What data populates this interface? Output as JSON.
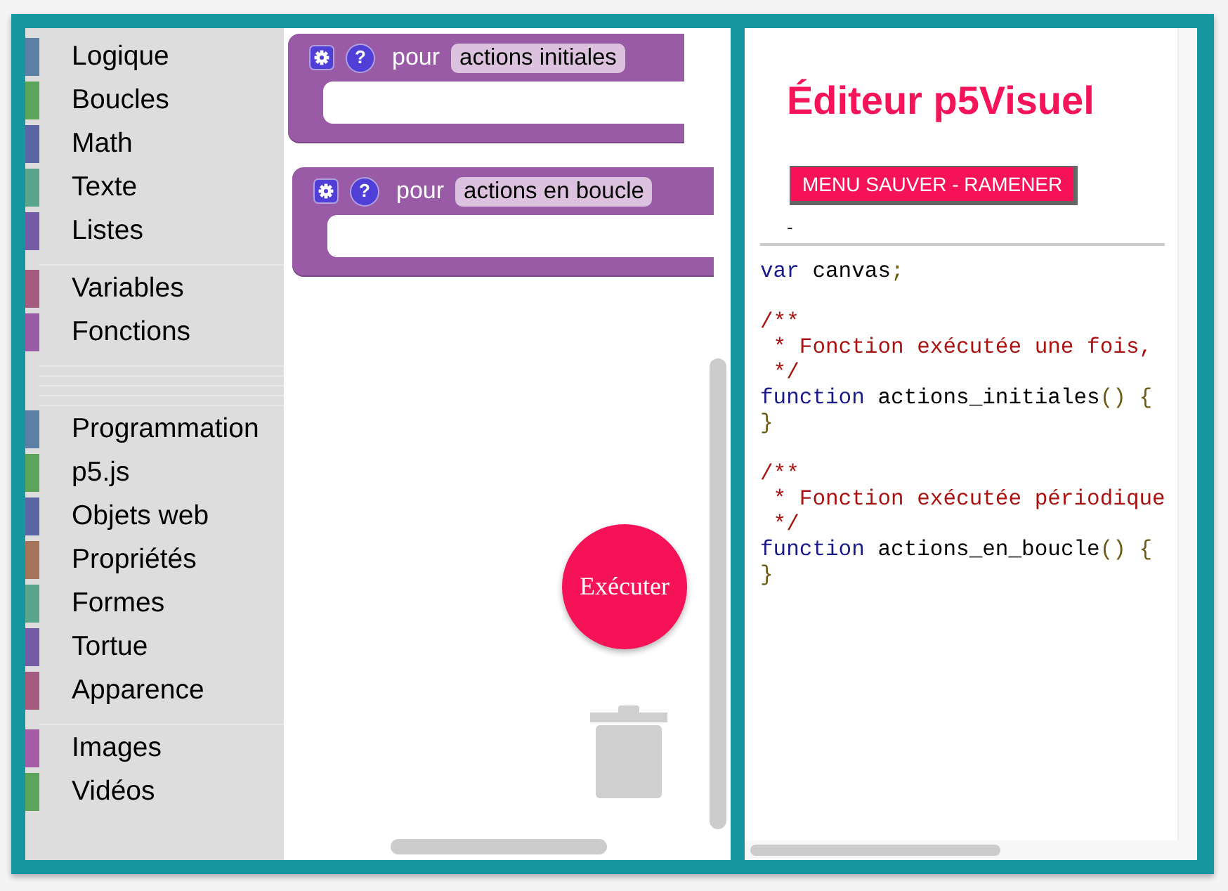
{
  "toolbox": {
    "entries": [
      {
        "kind": "category",
        "label": "Logique",
        "color": "#5b80a5"
      },
      {
        "kind": "category",
        "label": "Boucles",
        "color": "#5ba55b"
      },
      {
        "kind": "category",
        "label": "Math",
        "color": "#5b67a5"
      },
      {
        "kind": "category",
        "label": "Texte",
        "color": "#5ba58c"
      },
      {
        "kind": "category",
        "label": "Listes",
        "color": "#745ba5"
      },
      {
        "kind": "separator"
      },
      {
        "kind": "category",
        "label": "Variables",
        "color": "#a55b80"
      },
      {
        "kind": "category",
        "label": "Fonctions",
        "color": "#995ba5"
      },
      {
        "kind": "separator"
      },
      {
        "kind": "separator"
      },
      {
        "kind": "separator"
      },
      {
        "kind": "separator"
      },
      {
        "kind": "separator"
      },
      {
        "kind": "category",
        "label": "Programmation",
        "color": "#5b80a5"
      },
      {
        "kind": "category",
        "label": "p5.js",
        "color": "#5ba55b"
      },
      {
        "kind": "category",
        "label": "Objets web",
        "color": "#5b67a5"
      },
      {
        "kind": "category",
        "label": "Propriétés",
        "color": "#a5745b"
      },
      {
        "kind": "category",
        "label": "Formes",
        "color": "#5ba58c"
      },
      {
        "kind": "category",
        "label": "Tortue",
        "color": "#745ba5"
      },
      {
        "kind": "category",
        "label": "Apparence",
        "color": "#a55b80"
      },
      {
        "kind": "separator"
      },
      {
        "kind": "category",
        "label": "Images",
        "color": "#a55ba5"
      },
      {
        "kind": "category",
        "label": "Vidéos",
        "color": "#5ba55b"
      }
    ]
  },
  "workspace": {
    "blocks": [
      {
        "help": "?",
        "keyword": "pour",
        "field": "actions initiales"
      },
      {
        "help": "?",
        "keyword": "pour",
        "field": "actions en boucle"
      }
    ],
    "run_button": "Exécuter"
  },
  "editor": {
    "title": "Éditeur p5Visuel",
    "menu_button": "MENU SAUVER - RAMENER",
    "dash": "-",
    "code_blocks": [
      [
        [
          {
            "kind": "keyword",
            "text": "var"
          },
          {
            "kind": "plain",
            "text": " canvas"
          },
          {
            "kind": "punct",
            "text": ";"
          }
        ]
      ],
      [
        [
          {
            "kind": "comment",
            "text": "/**"
          }
        ],
        [
          {
            "kind": "comment",
            "text": " * Fonction exécutée une fois,"
          }
        ],
        [
          {
            "kind": "comment",
            "text": " */"
          }
        ],
        [
          {
            "kind": "keyword",
            "text": "function"
          },
          {
            "kind": "plain",
            "text": " actions_initiales"
          },
          {
            "kind": "punct",
            "text": "() {"
          }
        ],
        [
          {
            "kind": "punct",
            "text": "}"
          }
        ]
      ],
      [
        [
          {
            "kind": "comment",
            "text": "/**"
          }
        ],
        [
          {
            "kind": "comment",
            "text": " * Fonction exécutée périodique"
          }
        ],
        [
          {
            "kind": "comment",
            "text": " */"
          }
        ],
        [
          {
            "kind": "keyword",
            "text": "function"
          },
          {
            "kind": "plain",
            "text": " actions_en_boucle"
          },
          {
            "kind": "punct",
            "text": "() {"
          }
        ],
        [
          {
            "kind": "punct",
            "text": "}"
          }
        ]
      ]
    ]
  }
}
